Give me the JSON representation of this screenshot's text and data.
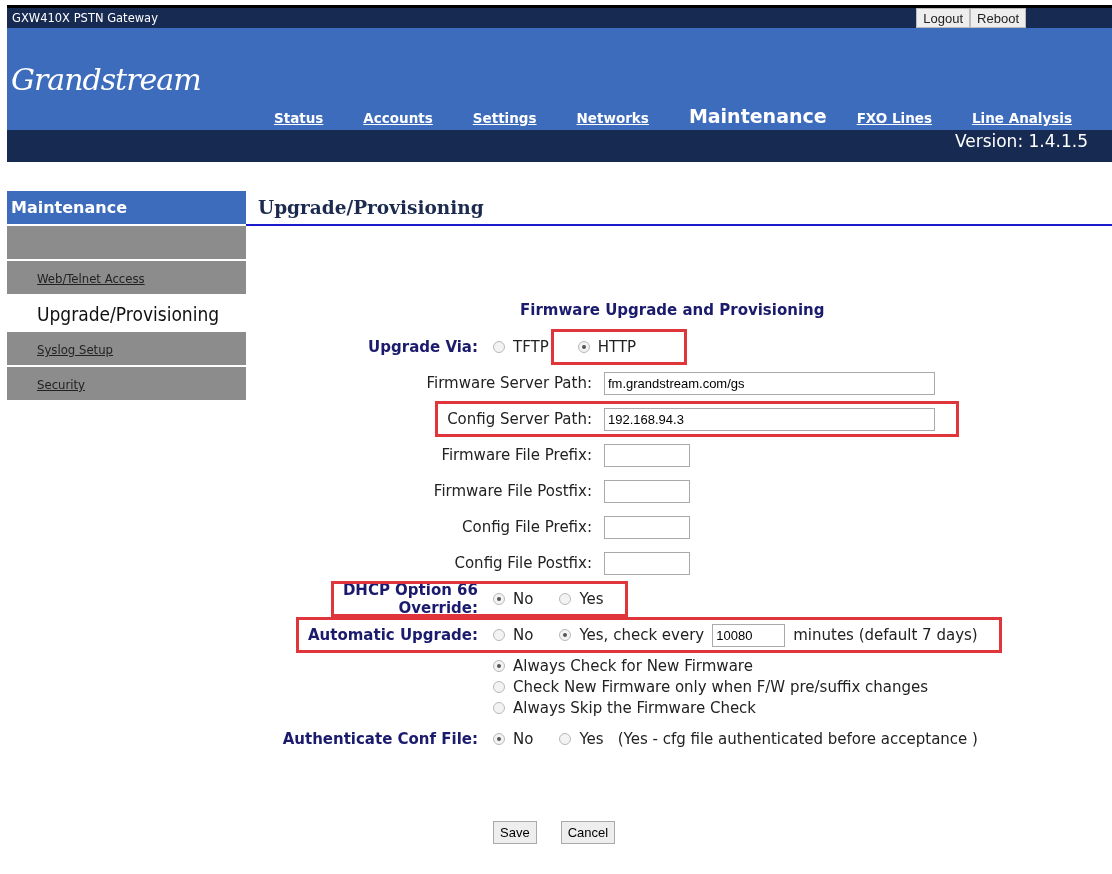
{
  "header": {
    "title": "GXW410X PSTN Gateway",
    "buttons": [
      "Logout",
      "Reboot"
    ],
    "logo": "Grandstream",
    "nav": [
      {
        "label": "Status",
        "selected": false
      },
      {
        "label": "Accounts",
        "selected": false
      },
      {
        "label": "Settings",
        "selected": false
      },
      {
        "label": "Networks",
        "selected": false
      },
      {
        "label": "Maintenance",
        "selected": true
      },
      {
        "label": "FXO Lines",
        "selected": false
      },
      {
        "label": "Line Analysis",
        "selected": false
      }
    ],
    "version": "Version: 1.4.1.5"
  },
  "sidebar": {
    "title": "Maintenance",
    "items": [
      {
        "label": "Web/Telnet Access",
        "selected": false
      },
      {
        "label": "Upgrade/Provisioning",
        "selected": true
      },
      {
        "label": "Syslog Setup",
        "selected": false
      },
      {
        "label": "Security",
        "selected": false
      }
    ]
  },
  "page_title": "Upgrade/Provisioning",
  "form": {
    "title": "Firmware Upgrade and Provisioning",
    "rows": [
      {
        "kind": "radio",
        "label": "Upgrade Via:",
        "highlighted": false,
        "options": [
          {
            "label": "TFTP",
            "selected": false,
            "highlighted": false
          },
          {
            "label": "HTTP",
            "selected": true,
            "highlighted": true
          }
        ]
      },
      {
        "kind": "field",
        "label": "Firmware Server Path:",
        "value": "fm.grandstream.com/gs",
        "wide": true,
        "highlighted": false
      },
      {
        "kind": "field",
        "label": "Config Server Path:",
        "value": "192.168.94.3",
        "wide": true,
        "highlighted": true
      },
      {
        "kind": "field",
        "label": "Firmware File Prefix:",
        "wide": false,
        "highlighted": false
      },
      {
        "kind": "field",
        "label": "Firmware File Postfix:",
        "wide": false,
        "highlighted": false
      },
      {
        "kind": "field",
        "label": "Config File Prefix:",
        "wide": false,
        "highlighted": false
      },
      {
        "kind": "field",
        "label": "Config File Postfix:",
        "wide": false,
        "highlighted": false
      },
      {
        "kind": "radio",
        "label": "DHCP Option 66\nOverride:",
        "highlighted": true,
        "options": [
          {
            "label": "No",
            "selected": true
          },
          {
            "label": "Yes",
            "selected": false
          }
        ]
      },
      {
        "kind": "radio",
        "label": "Automatic Upgrade:",
        "highlighted": true,
        "options": [
          {
            "label": "No",
            "selected": false
          },
          {
            "label": "Yes, check every",
            "selected": true,
            "input": "10080",
            "suffix": "minutes (default 7 days)"
          }
        ]
      },
      {
        "kind": "choices",
        "highlighted": false,
        "options": [
          {
            "label": "Always Check for New Firmware",
            "selected": true
          },
          {
            "label": "Check New Firmware only when F/W pre/suffix changes",
            "selected": false
          },
          {
            "label": "Always Skip the Firmware Check",
            "selected": false
          }
        ]
      },
      {
        "kind": "radio",
        "label": "Authenticate Conf File:",
        "highlighted": false,
        "options": [
          {
            "label": "No",
            "selected": true
          },
          {
            "label": "Yes",
            "selected": false
          }
        ],
        "note": "(Yes - cfg file authenticated before acceptance )"
      }
    ],
    "buttons": [
      "Save",
      "Cancel"
    ]
  }
}
